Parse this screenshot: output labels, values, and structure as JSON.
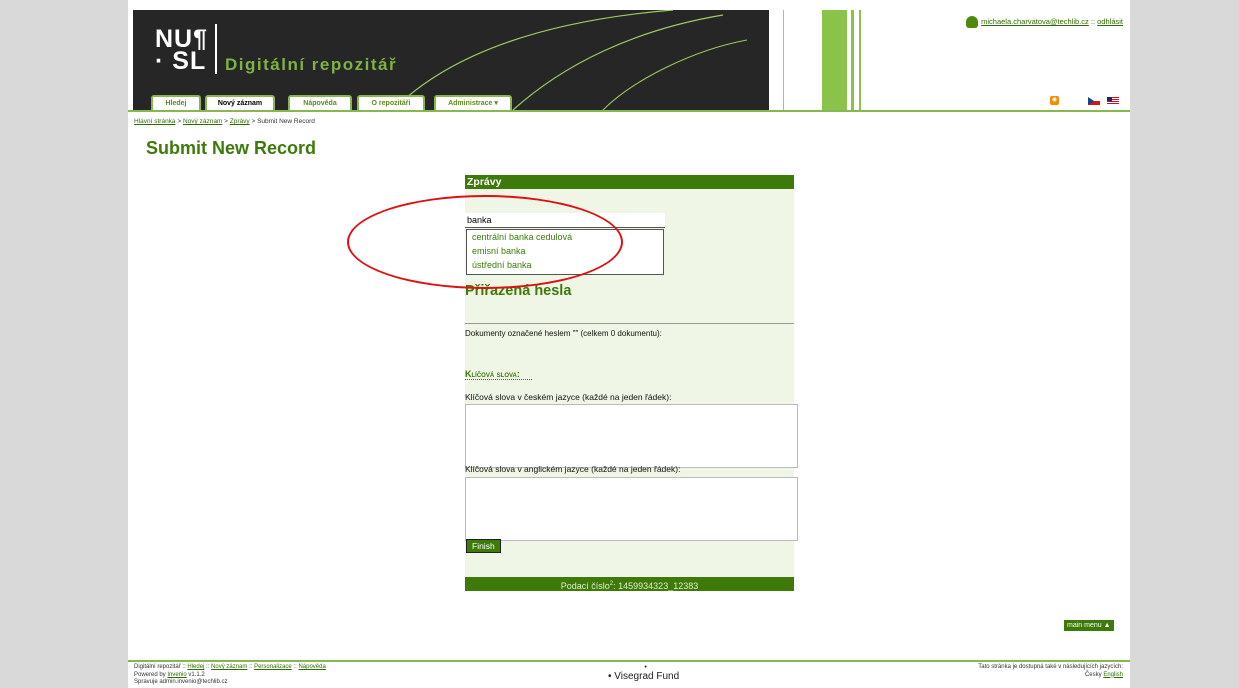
{
  "header": {
    "logo_line1": "NU¶",
    "logo_line2": "· SL",
    "logo_title": "Digitální repozitář",
    "tabs": [
      {
        "label": "Hledej"
      },
      {
        "label": "Nový záznam"
      },
      {
        "label": "Nápověda"
      },
      {
        "label": "O repozitáři"
      },
      {
        "label": "Administrace ▾"
      }
    ],
    "user_email": "michaela.charvatova@techlib.cz",
    "user_sep": " :: ",
    "logout": "odhlásit",
    "rss_icon": "rss-icon",
    "colors": {
      "accent": "#3d7a0a",
      "header_bg": "#262626",
      "line": "#86b84f"
    }
  },
  "breadcrumb": {
    "items": [
      "Hlavní stránka",
      "Nový záznam",
      "Zprávy",
      "Submit New Record"
    ],
    "sep": " > "
  },
  "page_title": "Submit New Record",
  "form": {
    "panel_title": "Zprávy",
    "search_value": "banka",
    "suggestions": [
      "centrální banka cedulová",
      "emisní banka",
      "ústřední banka"
    ],
    "assigned_title": "Přiřazená hesla",
    "docs_label": "Dokumenty označené heslem \"\" (celkem 0 dokumentu):",
    "keywords_heading": "Klíčová slova:",
    "kw_cz_label": "Klíčová slova v českém jazyce (každé na jeden řádek):",
    "kw_en_label": "Klíčová slova v anglickém jazyce (každé na jeden řádek):",
    "finish_label": "Finish",
    "submission_label": "Podací číslo",
    "submission_sup": "2",
    "submission_value": ": 1459934323_12383"
  },
  "main_menu": "main menu",
  "footer": {
    "left_line1_prefix": "Digitální repozitář :: ",
    "left_links": [
      "Hledej",
      "Nový záznam",
      "Personalizace",
      "Nápověda"
    ],
    "powered_prefix": "Powered by ",
    "powered_link": "Invenio",
    "powered_suffix": " v1.1.2",
    "maintained": "Spravuje admin.invenio@techlib.cz",
    "mid_bullet": "•",
    "mid_item": "• Visegrad Fund",
    "right_line1": "Tato stránka je dostupná také v následujících jazycích:",
    "lang_cz": "Česky",
    "lang_en": "English"
  }
}
